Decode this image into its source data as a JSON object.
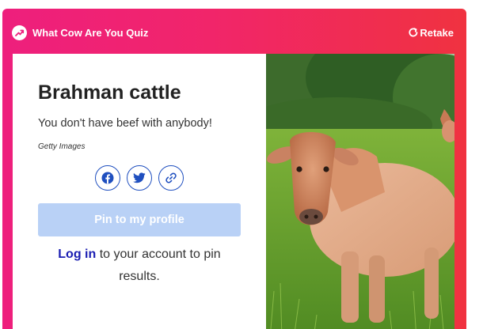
{
  "header": {
    "brand_title": "What Cow Are You Quiz",
    "retake_label": "Retake"
  },
  "result": {
    "title": "Brahman cattle",
    "description": "You don't have beef with anybody!",
    "image_credit": "Getty Images"
  },
  "share": {
    "icons": [
      "facebook-icon",
      "twitter-icon",
      "link-icon"
    ]
  },
  "pin_button_label": "Pin to my profile",
  "login": {
    "link_text": "Log in",
    "line1_rest": " to your account to pin",
    "line2": "results."
  },
  "colors": {
    "accent_gradient_start": "#ee1f7d",
    "accent_gradient_end": "#f03240",
    "share_icon_blue": "#1f4fbf",
    "pin_button_disabled": "#b9d1f6",
    "link_blue": "#1a1db2"
  }
}
